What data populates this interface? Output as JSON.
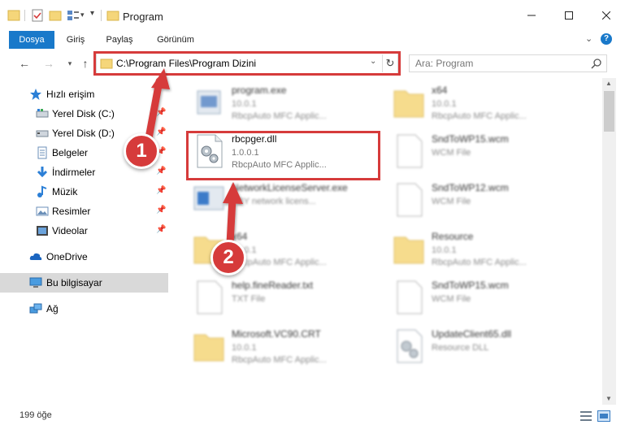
{
  "window": {
    "title": "Program",
    "controls": [
      "minimize-icon",
      "maximize-icon",
      "close-icon"
    ]
  },
  "ribbon": {
    "tabs": [
      {
        "label": "Dosya",
        "active": true
      },
      {
        "label": "Giriş"
      },
      {
        "label": "Paylaş"
      },
      {
        "label": "Görünüm"
      }
    ]
  },
  "address": {
    "path": "C:\\Program Files\\Program Dizini",
    "search_placeholder": "Ara: Program"
  },
  "sidebar": {
    "items": [
      {
        "label": "Hızlı erişim",
        "icon": "star-icon"
      },
      {
        "label": "Yerel Disk (C:)",
        "icon": "drive-icon",
        "pinned": true
      },
      {
        "label": "Yerel Disk (D:)",
        "icon": "drive-icon",
        "pinned": true
      },
      {
        "label": "Belgeler",
        "icon": "documents-icon",
        "pinned": true
      },
      {
        "label": "İndirmeler",
        "icon": "download-icon",
        "pinned": true
      },
      {
        "label": "Müzik",
        "icon": "music-icon",
        "pinned": true
      },
      {
        "label": "Resimler",
        "icon": "pictures-icon",
        "pinned": true
      },
      {
        "label": "Videolar",
        "icon": "videos-icon",
        "pinned": true
      },
      {
        "label": "OneDrive",
        "icon": "cloud-icon"
      },
      {
        "label": "Bu bilgisayar",
        "icon": "computer-icon",
        "selected": true
      },
      {
        "label": "Ağ",
        "icon": "network-icon"
      }
    ]
  },
  "files": [
    {
      "name": "program.exe",
      "line1": "10.0.1",
      "line2": "RbcpAuto MFC Applic...",
      "icon": "exe-icon"
    },
    {
      "name": "x64",
      "line1": "10.0.1",
      "line2": "RbcpAuto MFC Applic...",
      "icon": "folder-icon"
    },
    {
      "name": "rbcpger.dll",
      "line1": "1.0.0.1",
      "line2": "RbcpAuto MFC Applic...",
      "icon": "dll-gear-icon"
    },
    {
      "name": "SndToWP15.wcm",
      "line1": "WCM File",
      "line2": "",
      "icon": "blank-file-icon"
    },
    {
      "name": "NetworkLicenseServer.exe",
      "line1": "BBY network licens...",
      "line2": "",
      "icon": "exe-icon"
    },
    {
      "name": "SndToWP12.wcm",
      "line1": "WCM File",
      "line2": "",
      "icon": "blank-file-icon"
    },
    {
      "name": "x64",
      "line1": "10.0.1",
      "line2": "RbcpAuto MFC Applic...",
      "icon": "folder-icon"
    },
    {
      "name": "Resource",
      "line1": "10.0.1",
      "line2": "RbcpAuto MFC Applic...",
      "icon": "folder-icon"
    },
    {
      "name": "help.fineReader.txt",
      "line1": "TXT File",
      "line2": "",
      "icon": "blank-file-icon"
    },
    {
      "name": "SndToWP15.wcm",
      "line1": "WCM File",
      "line2": "",
      "icon": "blank-file-icon"
    },
    {
      "name": "Microsoft.VC90.CRT",
      "line1": "10.0.1",
      "line2": "RbcpAuto MFC Applic...",
      "icon": "folder-icon"
    },
    {
      "name": "UpdateClient65.dll",
      "line1": "Resource DLL",
      "line2": "",
      "icon": "dll-gear-icon"
    }
  ],
  "status": {
    "item_count": "199 öğe"
  },
  "annotations": [
    {
      "number": "1",
      "target": "address-bar"
    },
    {
      "number": "2",
      "target": "rbcpger.dll"
    }
  ],
  "colors": {
    "accent": "#1979ca",
    "annotation": "#d63b3b",
    "selection": "#d9d9d9"
  }
}
